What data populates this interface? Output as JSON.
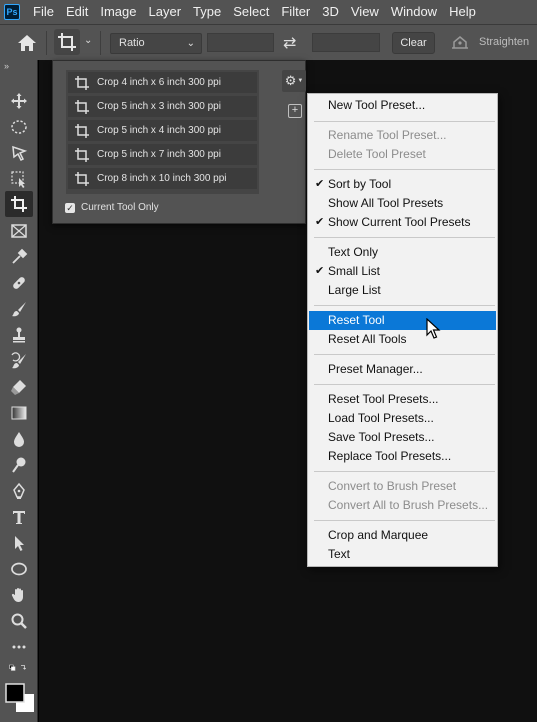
{
  "menubar": {
    "logo": "Ps",
    "items": [
      "File",
      "Edit",
      "Image",
      "Layer",
      "Type",
      "Select",
      "Filter",
      "3D",
      "View",
      "Window",
      "Help"
    ]
  },
  "options": {
    "ratio_value": "Ratio",
    "clear_label": "Clear",
    "straighten_label": "Straighten"
  },
  "preset_panel": {
    "presets": [
      "Crop 4 inch x 6 inch 300 ppi",
      "Crop 5 inch x 3 inch 300 ppi",
      "Crop 5 inch x 4 inch 300 ppi",
      "Crop 5 inch x 7 inch 300 ppi",
      "Crop 8 inch x 10 inch 300 ppi"
    ],
    "current_tool_only_label": "Current Tool Only",
    "current_tool_only_checked": true
  },
  "context_menu": {
    "groups": [
      [
        {
          "label": "New Tool Preset...",
          "enabled": true
        }
      ],
      [
        {
          "label": "Rename Tool Preset...",
          "enabled": false
        },
        {
          "label": "Delete Tool Preset",
          "enabled": false
        }
      ],
      [
        {
          "label": "Sort by Tool",
          "enabled": true,
          "checked": true
        },
        {
          "label": "Show All Tool Presets",
          "enabled": true
        },
        {
          "label": "Show Current Tool Presets",
          "enabled": true,
          "checked": true
        }
      ],
      [
        {
          "label": "Text Only",
          "enabled": true
        },
        {
          "label": "Small List",
          "enabled": true,
          "checked": true
        },
        {
          "label": "Large List",
          "enabled": true
        }
      ],
      [
        {
          "label": "Reset Tool",
          "enabled": true,
          "highlighted": true
        },
        {
          "label": "Reset All Tools",
          "enabled": true
        }
      ],
      [
        {
          "label": "Preset Manager...",
          "enabled": true
        }
      ],
      [
        {
          "label": "Reset Tool Presets...",
          "enabled": true
        },
        {
          "label": "Load Tool Presets...",
          "enabled": true
        },
        {
          "label": "Save Tool Presets...",
          "enabled": true
        },
        {
          "label": "Replace Tool Presets...",
          "enabled": true
        }
      ],
      [
        {
          "label": "Convert to Brush Preset",
          "enabled": false
        },
        {
          "label": "Convert All to Brush Presets...",
          "enabled": false
        }
      ],
      [
        {
          "label": "Crop and Marquee",
          "enabled": true
        },
        {
          "label": "Text",
          "enabled": true
        }
      ]
    ]
  },
  "toolbar": {
    "tools": [
      "move-tool",
      "marquee-tool",
      "lasso-tool",
      "object-select-tool",
      "crop-tool",
      "frame-tool",
      "eyedropper-tool",
      "healing-brush-tool",
      "brush-tool",
      "clone-stamp-tool",
      "history-brush-tool",
      "eraser-tool",
      "gradient-tool",
      "blur-tool",
      "dodge-tool",
      "pen-tool",
      "type-tool",
      "path-select-tool",
      "ellipse-tool",
      "hand-tool",
      "zoom-tool",
      "edit-toolbar"
    ],
    "active": "crop-tool"
  },
  "colors": {
    "chrome": "#535353",
    "canvas": "#101010",
    "menu_bg": "#f2f2f2",
    "highlight": "#0b78d7"
  }
}
